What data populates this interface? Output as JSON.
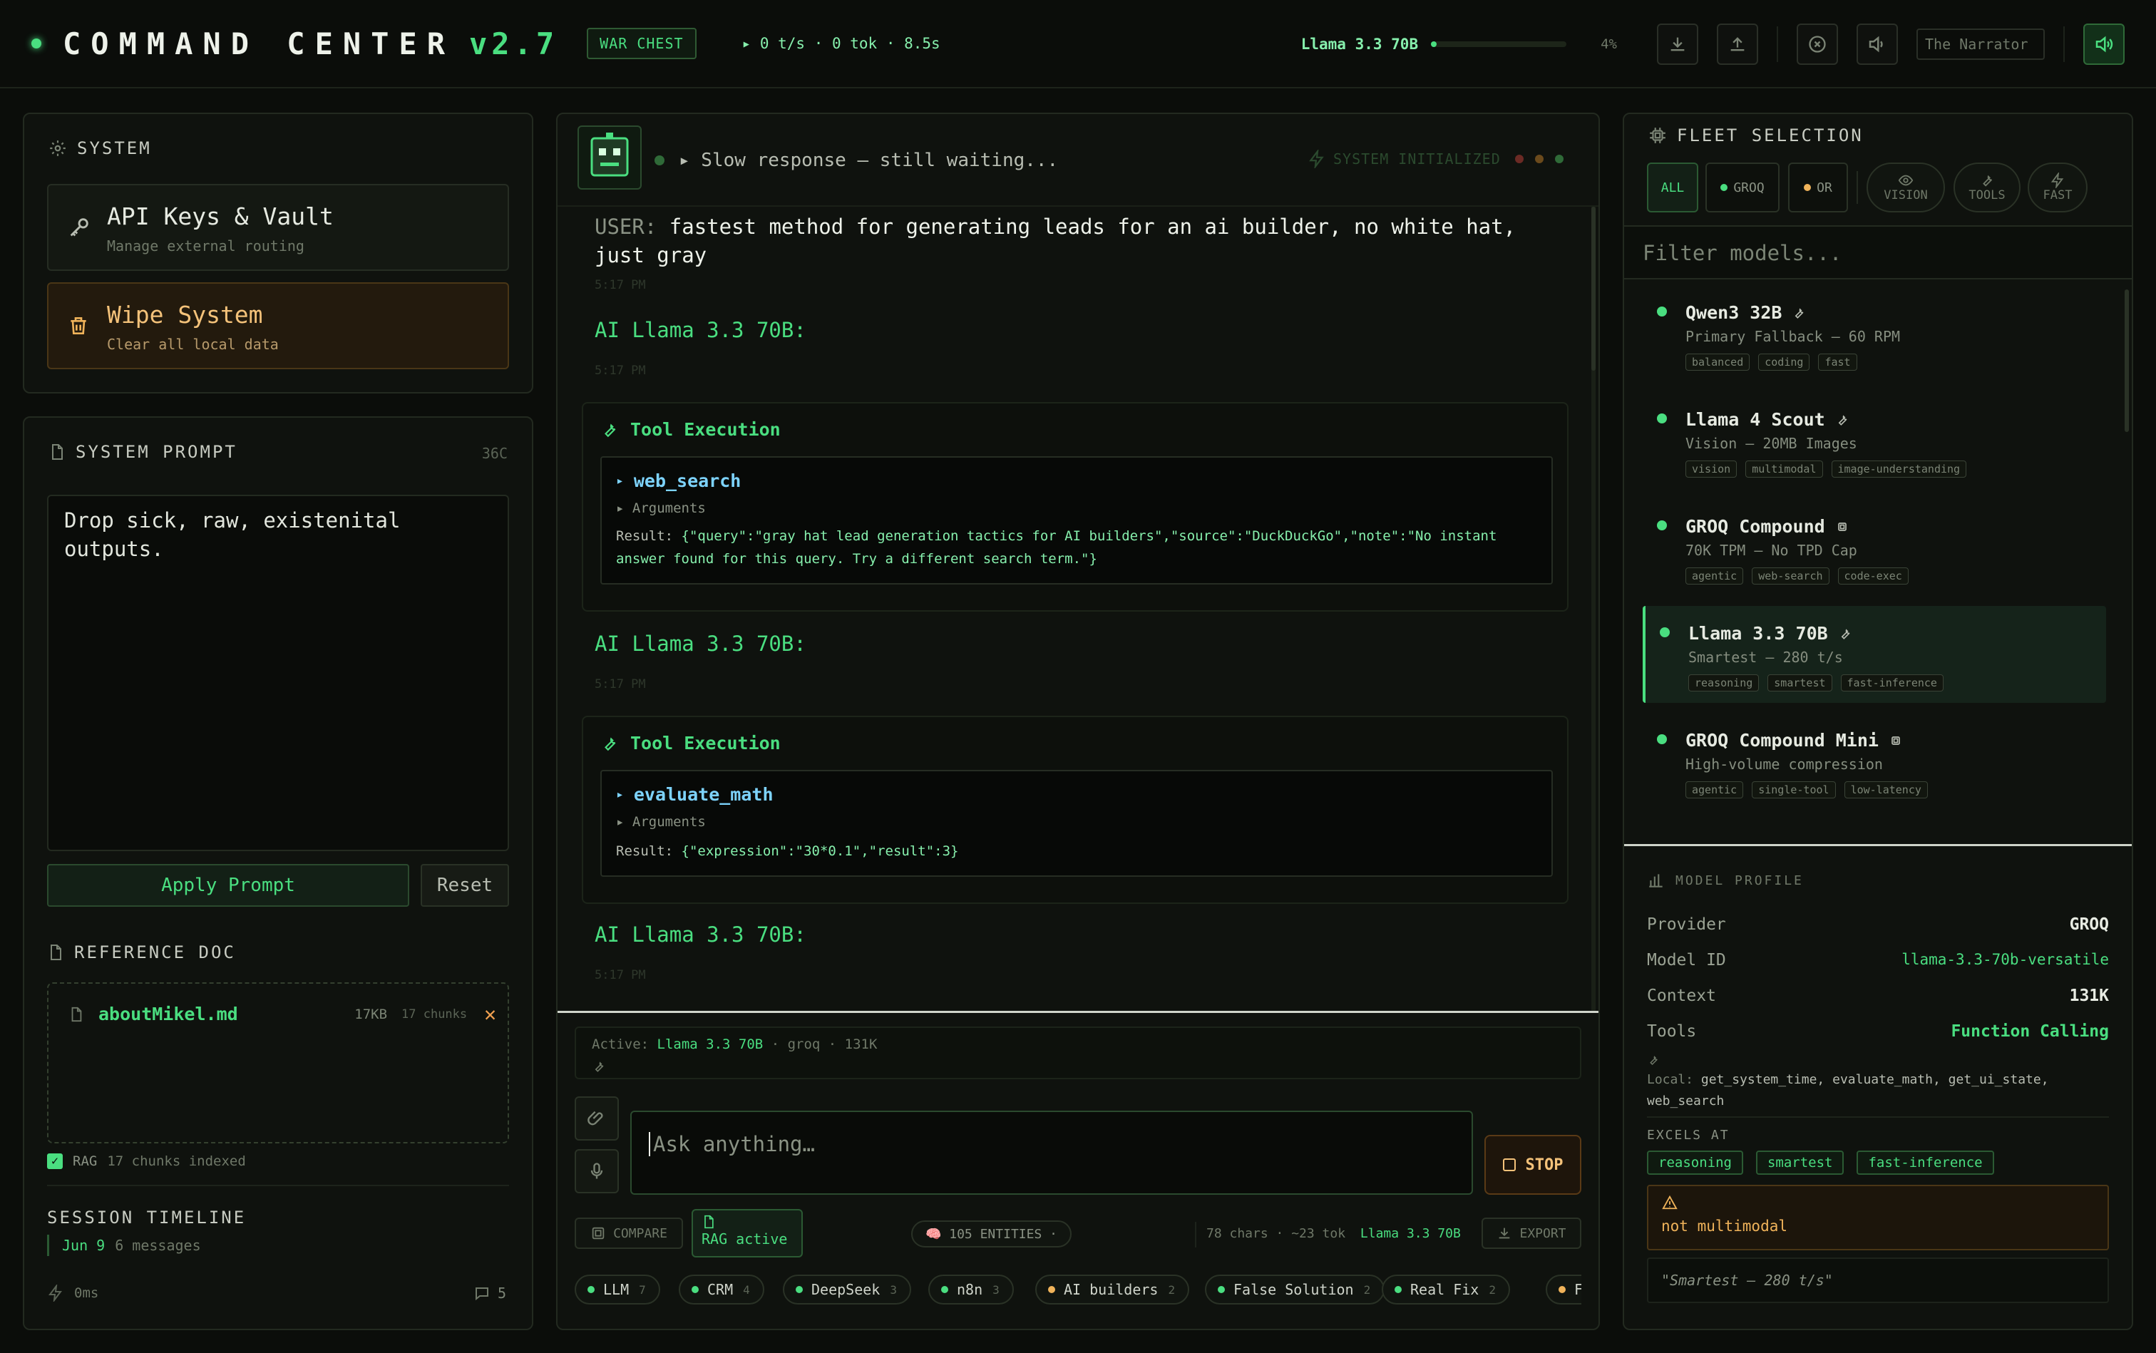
{
  "topbar": {
    "title": "COMMAND CENTER",
    "version": "v2.7",
    "badge": "WAR CHEST",
    "stats": "▸ 0 t/s · 0 tok · 8.5s",
    "model": "Llama 3.3 70B",
    "progress_pct": 4,
    "progress_label": "4%",
    "narrator": "The Narrator"
  },
  "system": {
    "title": "SYSTEM",
    "api_title": "API Keys & Vault",
    "api_sub": "Manage external routing",
    "wipe_title": "Wipe System",
    "wipe_sub": "Clear all local data"
  },
  "prompt": {
    "title": "SYSTEM PROMPT",
    "count": "36C",
    "text": "Drop sick, raw, existenital outputs.",
    "apply": "Apply Prompt",
    "reset": "Reset"
  },
  "ref": {
    "title": "REFERENCE DOC",
    "file": "aboutMikel.md",
    "size": "17KB",
    "chunks": "17 chunks",
    "rag": "RAG",
    "rag_status": "17 chunks indexed"
  },
  "timeline": {
    "title": "SESSION TIMELINE",
    "date": "Jun 9",
    "msgs": "6 messages",
    "latency": "0ms",
    "count": "5"
  },
  "chat": {
    "status": "▸ Slow response — still waiting...",
    "sys_init": "SYSTEM INITIALIZED",
    "user_label": "USER:",
    "user_text": "fastest method for generating leads for an ai builder, no white hat, just gray",
    "time": "5:17 PM",
    "ai_label": "AI Llama 3.3 70B:",
    "tool_title": "Tool Execution",
    "args_label": "Arguments",
    "result_label": "Result:",
    "tool1_fn": "web_search",
    "tool1_result": "{\"query\":\"gray hat lead generation tactics for AI builders\",\"source\":\"DuckDuckGo\",\"note\":\"No instant answer found for this query. Try a different search term.\"}",
    "tool2_fn": "evaluate_math",
    "tool2_result": "{\"expression\":\"30*0.1\",\"result\":3}"
  },
  "composer": {
    "active_prefix": "Active:",
    "active_model": "Llama 3.3 70B",
    "active_rest": "· groq · 131K",
    "placeholder": "Ask anything…",
    "stop": "STOP",
    "compare": "COMPARE",
    "rag_active": "RAG active",
    "entities": "🧠 105 ENTITIES ·",
    "meta": "78 chars · ~23 tok",
    "meta_model": "Llama 3.3 70B",
    "export": "EXPORT",
    "chips": [
      {
        "label": "LLM",
        "n": "7",
        "color": "#4ade80"
      },
      {
        "label": "CRM",
        "n": "4",
        "color": "#4ade80"
      },
      {
        "label": "DeepSeek",
        "n": "3",
        "color": "#4ade80"
      },
      {
        "label": "n8n",
        "n": "3",
        "color": "#4ade80"
      },
      {
        "label": "AI builders",
        "n": "2",
        "color": "#f0b35a"
      },
      {
        "label": "False Solution",
        "n": "2",
        "color": "#4ade80"
      },
      {
        "label": "Real Fix",
        "n": "2",
        "color": "#4ade80"
      },
      {
        "label": "F",
        "n": "",
        "color": "#f0b35a"
      }
    ]
  },
  "fleet": {
    "title": "FLEET SELECTION",
    "filter_all": "ALL",
    "filter_groq": "GROQ",
    "filter_or": "OR",
    "cap_vision": "VISION",
    "cap_tools": "TOOLS",
    "cap_fast": "FAST",
    "search_placeholder": "Filter models...",
    "models": [
      {
        "name": "Qwen3 32B",
        "desc": "Primary Fallback — 60 RPM",
        "tags": [
          "balanced",
          "coding",
          "fast"
        ],
        "icon": "wrench-icon"
      },
      {
        "name": "Llama 4 Scout",
        "desc": "Vision — 20MB Images",
        "tags": [
          "vision",
          "multimodal",
          "image-understanding"
        ],
        "icon": "wrench-icon"
      },
      {
        "name": "GROQ Compound",
        "desc": "70K TPM — No TPD Cap",
        "tags": [
          "agentic",
          "web-search",
          "code-exec"
        ],
        "icon": "chip-icon"
      },
      {
        "name": "Llama 3.3 70B",
        "desc": "Smartest — 280 t/s",
        "tags": [
          "reasoning",
          "smartest",
          "fast-inference"
        ],
        "icon": "wrench-icon"
      },
      {
        "name": "GROQ Compound Mini",
        "desc": "High-volume compression",
        "tags": [
          "agentic",
          "single-tool",
          "low-latency"
        ],
        "icon": "chip-icon"
      }
    ]
  },
  "profile": {
    "title": "MODEL PROFILE",
    "provider_k": "Provider",
    "provider_v": "GROQ",
    "id_k": "Model ID",
    "id_v": "llama-3.3-70b-versatile",
    "ctx_k": "Context",
    "ctx_v": "131K",
    "tools_k": "Tools",
    "tools_v": "Function Calling",
    "local_prefix": "Local:",
    "local_tools": "get_system_time, evaluate_math, get_ui_state, web_search",
    "excels_title": "EXCELS AT",
    "excels": [
      "reasoning",
      "smartest",
      "fast-inference"
    ],
    "warn": "not multimodal",
    "quote": "\"Smartest — 280 t/s\""
  }
}
